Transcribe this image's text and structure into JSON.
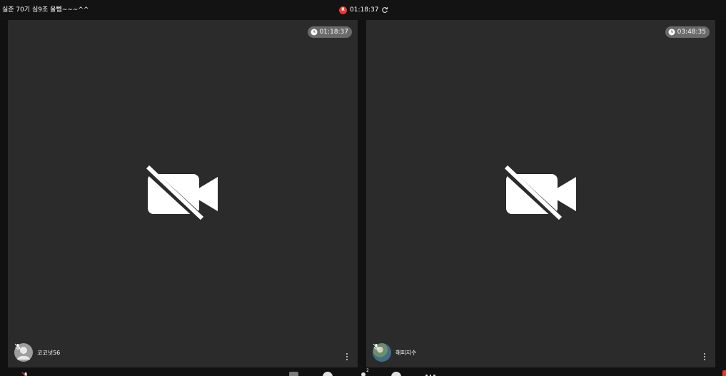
{
  "header": {
    "meeting_title": "실준 70기 심9조 올뻼~~~^^",
    "recording_badge": "R",
    "recording_time": "01:18:37"
  },
  "tiles": [
    {
      "timer": "01:18:37",
      "participant_name": "코코넛56",
      "avatar": "default-avatar",
      "camera_state": "camera-off-icon"
    },
    {
      "timer": "03:48:35",
      "participant_name": "해피지수",
      "avatar": "photo-avatar",
      "camera_state": "camera-off-icon"
    }
  ],
  "toolbar": {
    "people_count": "2"
  },
  "colors": {
    "background": "#111111",
    "tile": "#2b2b2b",
    "timer_pill": "#6a6a6a",
    "recording": "#e53935",
    "end_call": "#e53935"
  }
}
